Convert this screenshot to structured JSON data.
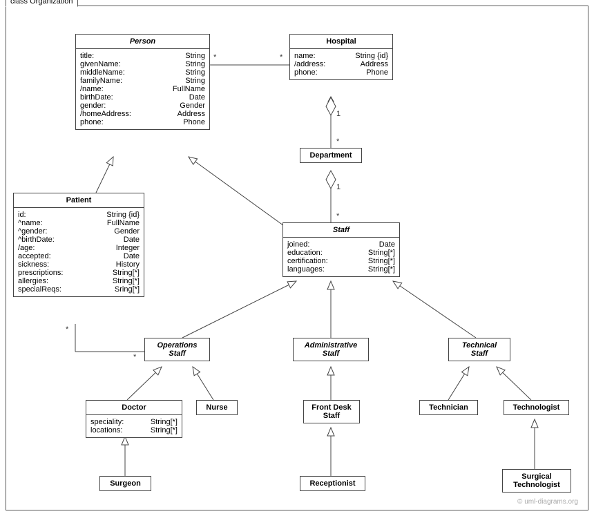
{
  "package": {
    "label": "class Organization"
  },
  "classes": {
    "person": {
      "name": "Person",
      "attrs": [
        {
          "n": "title:",
          "t": "String"
        },
        {
          "n": "givenName:",
          "t": "String"
        },
        {
          "n": "middleName:",
          "t": "String"
        },
        {
          "n": "familyName:",
          "t": "String"
        },
        {
          "n": "/name:",
          "t": "FullName"
        },
        {
          "n": "birthDate:",
          "t": "Date"
        },
        {
          "n": "gender:",
          "t": "Gender"
        },
        {
          "n": "/homeAddress:",
          "t": "Address"
        },
        {
          "n": "phone:",
          "t": "Phone"
        }
      ]
    },
    "hospital": {
      "name": "Hospital",
      "attrs": [
        {
          "n": "name:",
          "t": "String {id}"
        },
        {
          "n": "/address:",
          "t": "Address"
        },
        {
          "n": "phone:",
          "t": "Phone"
        }
      ]
    },
    "department": {
      "name": "Department"
    },
    "patient": {
      "name": "Patient",
      "attrs": [
        {
          "n": "id:",
          "t": "String {id}"
        },
        {
          "n": "^name:",
          "t": "FullName"
        },
        {
          "n": "^gender:",
          "t": "Gender"
        },
        {
          "n": "^birthDate:",
          "t": "Date"
        },
        {
          "n": "/age:",
          "t": "Integer"
        },
        {
          "n": "accepted:",
          "t": "Date"
        },
        {
          "n": "sickness:",
          "t": "History"
        },
        {
          "n": "prescriptions:",
          "t": "String[*]"
        },
        {
          "n": "allergies:",
          "t": "String[*]"
        },
        {
          "n": "specialReqs:",
          "t": "Sring[*]"
        }
      ]
    },
    "staff": {
      "name": "Staff",
      "attrs": [
        {
          "n": "joined:",
          "t": "Date"
        },
        {
          "n": "education:",
          "t": "String[*]"
        },
        {
          "n": "certification:",
          "t": "String[*]"
        },
        {
          "n": "languages:",
          "t": "String[*]"
        }
      ]
    },
    "opstaff": {
      "name": "OperationsStaff",
      "display": "Operations\nStaff"
    },
    "adminstaff": {
      "name": "AdministrativeStaff",
      "display": "Administrative\nStaff"
    },
    "techstaff": {
      "name": "TechnicalStaff",
      "display": "Technical\nStaff"
    },
    "doctor": {
      "name": "Doctor",
      "attrs": [
        {
          "n": "speciality:",
          "t": "String[*]"
        },
        {
          "n": "locations:",
          "t": "String[*]"
        }
      ]
    },
    "nurse": {
      "name": "Nurse"
    },
    "frontdesk": {
      "name": "FrontDeskStaff",
      "display": "Front Desk\nStaff"
    },
    "receptionist": {
      "name": "Receptionist"
    },
    "technician": {
      "name": "Technician"
    },
    "technologist": {
      "name": "Technologist"
    },
    "surgeon": {
      "name": "Surgeon"
    },
    "surgtech": {
      "name": "SurgicalTechnologist",
      "display": "Surgical\nTechnologist"
    }
  },
  "mults": {
    "ph_star": "*",
    "hp_star": "*",
    "hd_1": "1",
    "hd_star": "*",
    "ds_1": "1",
    "ds_star": "*",
    "po_star1": "*",
    "po_star2": "*"
  },
  "watermark": "© uml-diagrams.org"
}
